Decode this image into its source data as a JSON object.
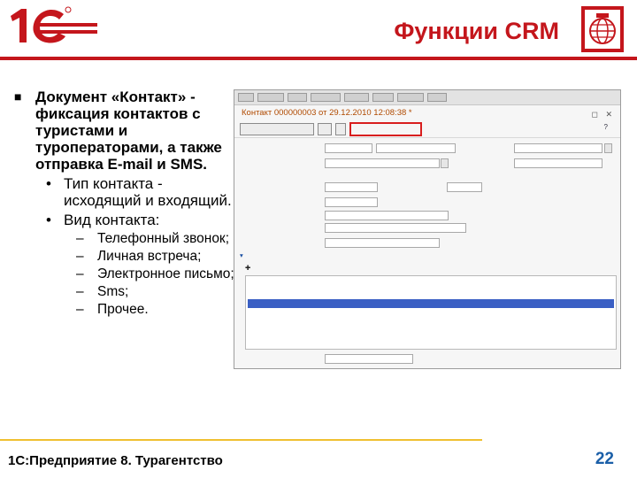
{
  "header": {
    "title": "Функции CRM",
    "logo_text": "1С"
  },
  "bullets": {
    "main": "Документ «Контакт» - фиксация контактов с туристами и туроператорами, а также отправка E-mail и SMS.",
    "sub1": "Тип контакта - исходящий и входящий.",
    "sub2": "Вид контакта:",
    "types": [
      "Телефонный звонок;",
      "Личная встреча;",
      "Электронное письмо;",
      "Sms;",
      "Прочее."
    ]
  },
  "window": {
    "title": "Контакт 000000003 от 29.12.2010 12:08:38 *"
  },
  "footer": {
    "text": "1С:Предприятие 8. Турагентство",
    "page": "22"
  },
  "colors": {
    "accent": "#c4161c",
    "page_number": "#1b5fa8",
    "footer_rule": "#f0c030"
  }
}
